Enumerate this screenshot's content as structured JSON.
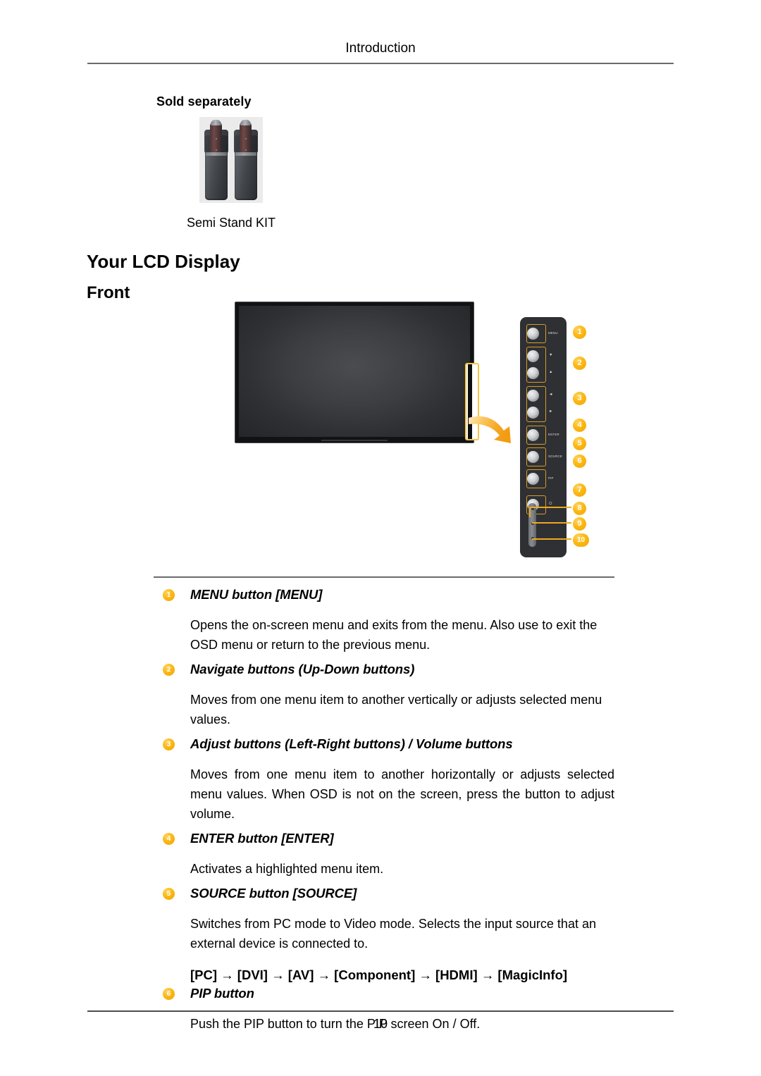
{
  "header": {
    "title": "Introduction"
  },
  "sold_separately": {
    "title": "Sold separately",
    "image_name": "semi-stand-kit-photo",
    "caption": "Semi Stand KIT"
  },
  "headings": {
    "your_lcd_display": "Your LCD Display",
    "front": "Front"
  },
  "figure": {
    "monitor_name": "lcd-display-front-view",
    "highlight_name": "control-panel-highlight",
    "arrow_name": "curved-arrow",
    "panel": {
      "buttons": [
        {
          "label": "MENU",
          "glyph": "",
          "badge": "1"
        },
        {
          "label": "",
          "glyph": "▼",
          "badge": "2"
        },
        {
          "label": "",
          "glyph": "▲",
          "badge": ""
        },
        {
          "label": "",
          "glyph": "◄",
          "badge": "3"
        },
        {
          "label": "",
          "glyph": "►",
          "badge": ""
        },
        {
          "label": "ENTER",
          "glyph": "",
          "badge": "4"
        },
        {
          "label": "SOURCE",
          "glyph": "",
          "badge": "5"
        },
        {
          "label": "PIP",
          "glyph": "",
          "badge": "6"
        },
        {
          "label": "",
          "glyph": "⏻",
          "badge": "7"
        }
      ],
      "sensor_badges": [
        "8",
        "9",
        "10"
      ]
    },
    "colors": {
      "badge_orange": "#fcb813",
      "highlight_orange": "#f6c445",
      "arrow_orange": "#f5a623",
      "panel_dark": "#2e3034"
    }
  },
  "descriptions": [
    {
      "num": "1",
      "title": "MENU button [MENU]",
      "body": "Opens the on-screen menu and exits from the menu. Also use to exit the OSD menu or return to the previous menu."
    },
    {
      "num": "2",
      "title": "Navigate buttons (Up-Down buttons)",
      "body": "Moves from one menu item to another vertically or adjusts selected menu values."
    },
    {
      "num": "3",
      "title": "Adjust buttons (Left-Right buttons) / Volume buttons",
      "body": "Moves from one menu item to another horizontally or adjusts selected menu values. When OSD is not on the screen, press the button to adjust volume."
    },
    {
      "num": "4",
      "title": "ENTER button [ENTER]",
      "body": "Activates a highlighted menu item."
    },
    {
      "num": "5",
      "title": "SOURCE button [SOURCE]",
      "body": "Switches from PC mode to Video mode. Selects the input source that an external device is connected to.",
      "extra": "[PC] → [DVI] → [AV] → [Component] → [HDMI] → [MagicInfo]"
    },
    {
      "num": "6",
      "title": "PIP button",
      "body": "Push the PIP button to turn the PIP screen On / Off."
    }
  ],
  "footer": {
    "page_number": "10"
  }
}
